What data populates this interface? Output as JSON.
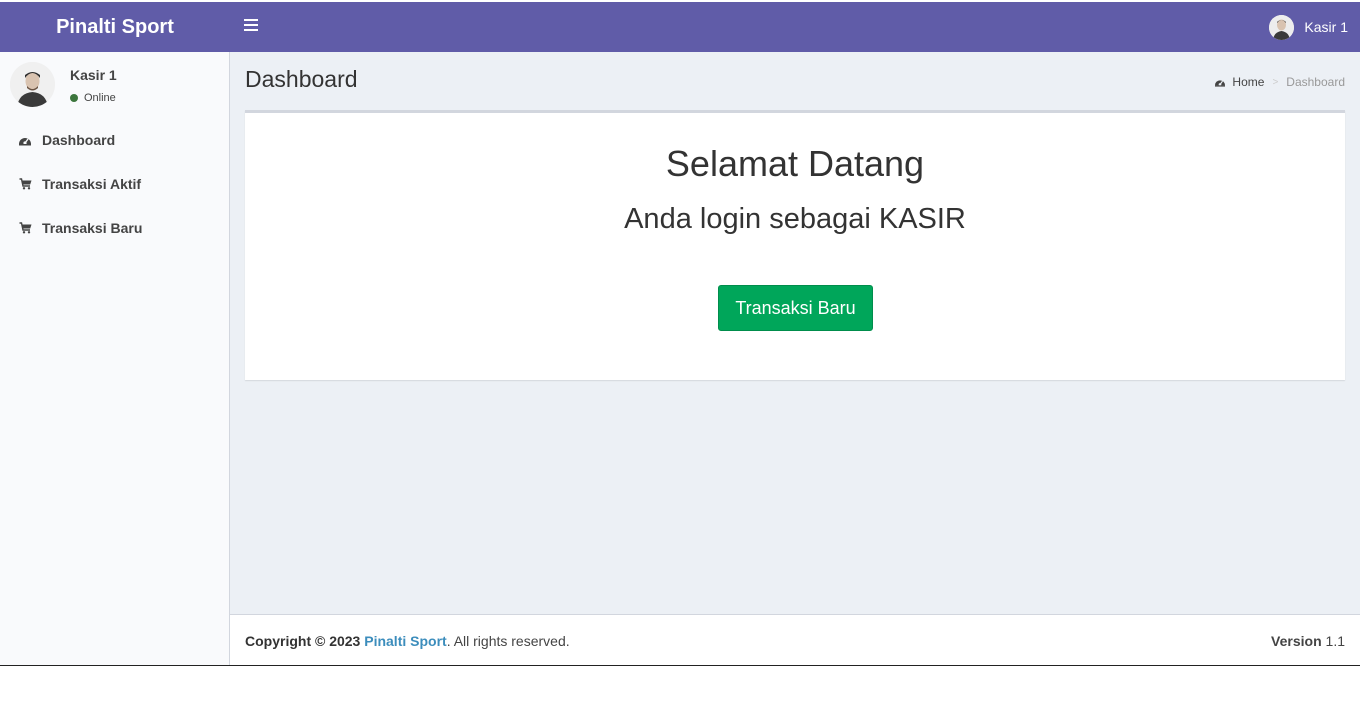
{
  "header": {
    "brand": "Pinalti Sport",
    "user_name": "Kasir 1"
  },
  "sidebar": {
    "user_name": "Kasir 1",
    "status": "Online",
    "items": [
      {
        "label": "Dashboard",
        "icon": "dashboard-icon"
      },
      {
        "label": "Transaksi Aktif",
        "icon": "cart-icon"
      },
      {
        "label": "Transaksi Baru",
        "icon": "cart-icon"
      }
    ]
  },
  "content": {
    "title": "Dashboard",
    "breadcrumb": {
      "home": "Home",
      "current": "Dashboard"
    },
    "welcome": "Selamat Datang",
    "role_text": "Anda login sebagai KASIR",
    "button_label": "Transaksi Baru"
  },
  "footer": {
    "copyright": "Copyright © 2023",
    "brand": "Pinalti Sport",
    "rights": ". All rights reserved.",
    "version_label": "Version",
    "version": "1.1"
  },
  "colors": {
    "header_bg": "#605ca8",
    "button_bg": "#00a65a",
    "status_online": "#3c763d",
    "link": "#3c8dbc"
  }
}
